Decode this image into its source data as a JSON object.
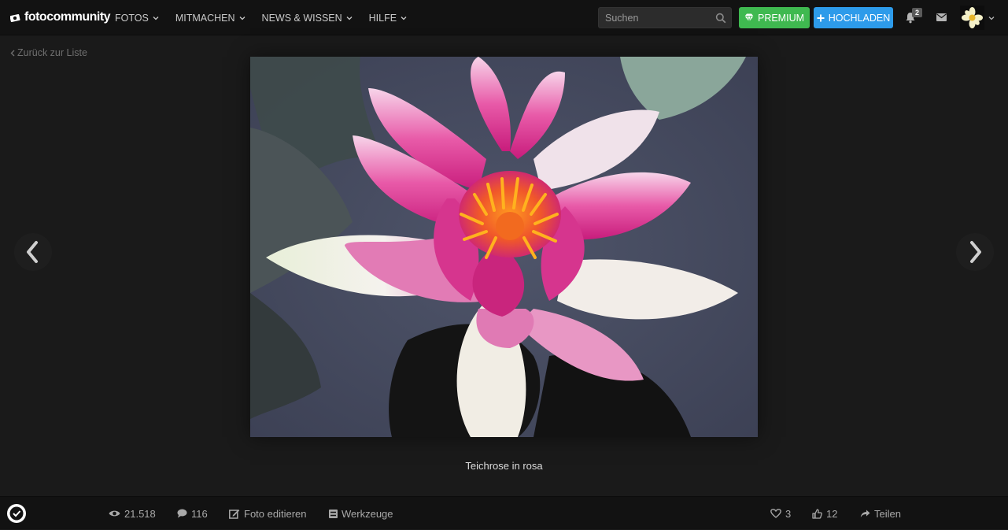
{
  "header": {
    "logo_text": "fotocommunity",
    "nav": [
      {
        "label": "FOTOS"
      },
      {
        "label": "MITMACHEN"
      },
      {
        "label": "NEWS & WISSEN"
      },
      {
        "label": "HILFE"
      }
    ],
    "search": {
      "placeholder": "Suchen",
      "value": ""
    },
    "premium_label": "PREMIUM",
    "upload_label": "HOCHLADEN",
    "notification_count": "2"
  },
  "back_link": "Zurück zur Liste",
  "photo": {
    "caption": "Teichrose in rosa"
  },
  "footer": {
    "views": "21.518",
    "comments": "116",
    "edit_label": "Foto editieren",
    "tools_label": "Werkzeuge",
    "favorites": "3",
    "likes": "12",
    "share_label": "Teilen"
  },
  "colors": {
    "premium": "#3fb950",
    "upload": "#2d9bea",
    "background": "#1a1a1a",
    "topbar": "#121212"
  },
  "icons": [
    "camera-logo-icon",
    "chevron-down-icon",
    "search-icon",
    "diamond-icon",
    "plus-icon",
    "bell-icon",
    "envelope-icon",
    "avatar-flower-icon",
    "chevron-left-icon",
    "chevron-right-icon",
    "eye-icon",
    "comment-icon",
    "edit-icon",
    "tools-icon",
    "heart-icon",
    "thumbs-up-icon",
    "share-icon",
    "verified-check-icon"
  ]
}
